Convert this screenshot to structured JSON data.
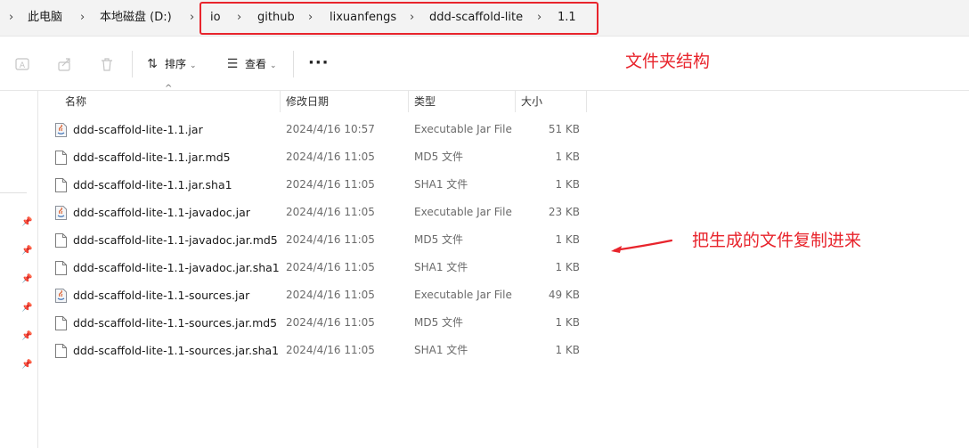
{
  "address": {
    "crumbs": [
      "此电脑",
      "本地磁盘 (D:)",
      "io",
      "github",
      "lixuanfengs",
      "ddd-scaffold-lite",
      "1.1"
    ],
    "separator": "›"
  },
  "toolbar": {
    "sort_label": "排序",
    "view_label": "查看",
    "more_label": "···"
  },
  "columns": {
    "name": "名称",
    "modified": "修改日期",
    "type": "类型",
    "size": "大小"
  },
  "files": [
    {
      "name": "ddd-scaffold-lite-1.1.jar",
      "date": "2024/4/16 10:57",
      "type": "Executable Jar File",
      "size": "51 KB",
      "icon": "jar-file-icon"
    },
    {
      "name": "ddd-scaffold-lite-1.1.jar.md5",
      "date": "2024/4/16 11:05",
      "type": "MD5 文件",
      "size": "1 KB",
      "icon": "file-icon"
    },
    {
      "name": "ddd-scaffold-lite-1.1.jar.sha1",
      "date": "2024/4/16 11:05",
      "type": "SHA1 文件",
      "size": "1 KB",
      "icon": "file-icon"
    },
    {
      "name": "ddd-scaffold-lite-1.1-javadoc.jar",
      "date": "2024/4/16 11:05",
      "type": "Executable Jar File",
      "size": "23 KB",
      "icon": "jar-file-icon"
    },
    {
      "name": "ddd-scaffold-lite-1.1-javadoc.jar.md5",
      "date": "2024/4/16 11:05",
      "type": "MD5 文件",
      "size": "1 KB",
      "icon": "file-icon"
    },
    {
      "name": "ddd-scaffold-lite-1.1-javadoc.jar.sha1",
      "date": "2024/4/16 11:05",
      "type": "SHA1 文件",
      "size": "1 KB",
      "icon": "file-icon"
    },
    {
      "name": "ddd-scaffold-lite-1.1-sources.jar",
      "date": "2024/4/16 11:05",
      "type": "Executable Jar File",
      "size": "49 KB",
      "icon": "jar-file-icon"
    },
    {
      "name": "ddd-scaffold-lite-1.1-sources.jar.md5",
      "date": "2024/4/16 11:05",
      "type": "MD5 文件",
      "size": "1 KB",
      "icon": "file-icon"
    },
    {
      "name": "ddd-scaffold-lite-1.1-sources.jar.sha1",
      "date": "2024/4/16 11:05",
      "type": "SHA1 文件",
      "size": "1 KB",
      "icon": "file-icon"
    }
  ],
  "annotations": {
    "folder_structure": "文件夹结构",
    "copy_note": "把生成的文件复制进来"
  },
  "colors": {
    "annotation": "#e8242c",
    "meta_text": "#6b6b6b"
  }
}
